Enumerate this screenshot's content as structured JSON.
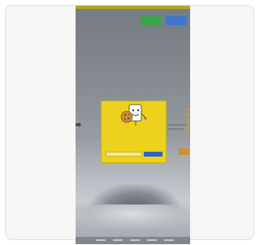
{
  "top_banner": {
    "text": ""
  },
  "header": {
    "logo": "",
    "primary_button_label": "",
    "secondary_button_label": ""
  },
  "hero": {
    "heading": ""
  },
  "modal": {
    "message": "",
    "email_placeholder": "",
    "submit_label": ""
  },
  "colors": {
    "banner": "#c6b21a",
    "modal_background": "#ecd11d",
    "primary_button": "#37b24a",
    "secondary_button": "#3d7ae0",
    "submit_button": "#2e64c5",
    "accent": "#e09a2e"
  },
  "icons": [
    "cookie-mascot-icon",
    "arrow-icon"
  ]
}
